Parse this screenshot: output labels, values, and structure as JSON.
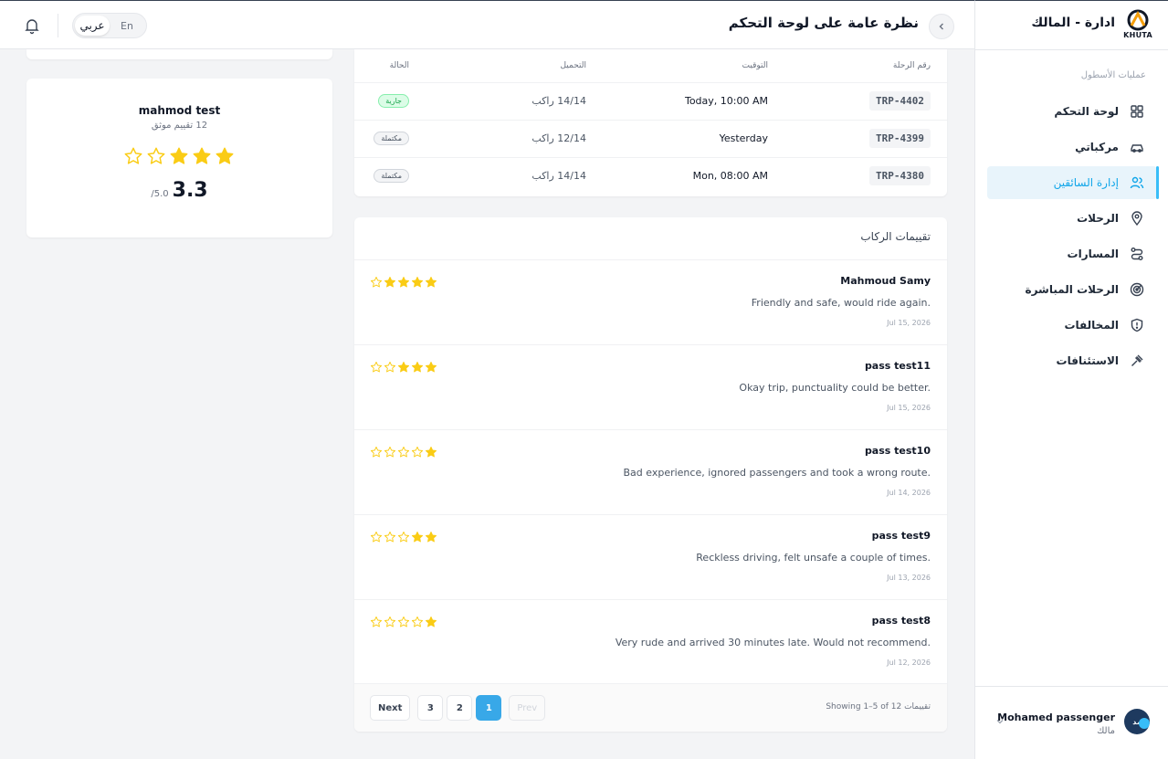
{
  "header": {
    "page_title": "نظرة عامة على لوحة التحكم",
    "lang_en": "En",
    "lang_ar": "عربي"
  },
  "sidebar": {
    "brand_name": "ادارة - المالك",
    "brand_logo_text": "KHUTA",
    "section_label": "عمليات الأسطول",
    "items": [
      {
        "label": "لوحة التحكم",
        "icon": "grid-icon"
      },
      {
        "label": "مركباتي",
        "icon": "car-icon"
      },
      {
        "label": "إدارة السائقين",
        "icon": "users-icon",
        "active": true
      },
      {
        "label": "الرحلات",
        "icon": "map-pin-icon"
      },
      {
        "label": "المسارات",
        "icon": "route-icon"
      },
      {
        "label": "الرحلات المباشرة",
        "icon": "radar-icon"
      },
      {
        "label": "المخالفات",
        "icon": "shield-alert-icon"
      },
      {
        "label": "الاستئنافات",
        "icon": "gavel-icon"
      }
    ],
    "user": {
      "name": "Mohamed passenger",
      "role": "مالك",
      "avatar_text": "مد"
    }
  },
  "driver": {
    "name": "mahmod test",
    "rating_count": "12 تقييم موثق",
    "score": "3.3",
    "score_max": "/5.0",
    "stars": 3
  },
  "trips": {
    "headers": {
      "id": "رقم الرحلة",
      "time": "التوقيت",
      "load": "التحميل",
      "status": "الحالة"
    },
    "rows": [
      {
        "id": "TRP-4402",
        "time": "Today, 10:00 AM",
        "load": "14/14 راكب",
        "status": "جارية",
        "status_type": "running"
      },
      {
        "id": "TRP-4399",
        "time": "Yesterday",
        "load": "12/14 راكب",
        "status": "مكتملة",
        "status_type": "completed"
      },
      {
        "id": "TRP-4380",
        "time": "Mon, 08:00 AM",
        "load": "14/14 راكب",
        "status": "مكتملة",
        "status_type": "completed"
      }
    ]
  },
  "ratings": {
    "title": "تقييمات الركاب",
    "reviews": [
      {
        "name": "Mahmoud Samy",
        "comment": "Friendly and safe, would ride again.",
        "date": "Jul 15, 2026",
        "stars": 4
      },
      {
        "name": "pass test11",
        "comment": "Okay trip, punctuality could be better.",
        "date": "Jul 15, 2026",
        "stars": 3
      },
      {
        "name": "pass test10",
        "comment": "Bad experience, ignored passengers and took a wrong route.",
        "date": "Jul 14, 2026",
        "stars": 1
      },
      {
        "name": "pass test9",
        "comment": "Reckless driving, felt unsafe a couple of times.",
        "date": "Jul 13, 2026",
        "stars": 2
      },
      {
        "name": "pass test8",
        "comment": "Very rude and arrived 30 minutes late. Would not recommend.",
        "date": "Jul 12, 2026",
        "stars": 1
      }
    ],
    "pagination": {
      "summary": "Showing 1–5 of 12 تقييمات",
      "prev": "Prev",
      "next": "Next",
      "pages": [
        "1",
        "2",
        "3"
      ],
      "current": "1"
    }
  },
  "colors": {
    "accent": "#38a8e8",
    "star": "#facc15",
    "running_green": "#16a34a"
  }
}
